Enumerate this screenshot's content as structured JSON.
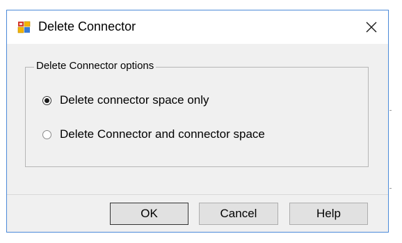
{
  "window": {
    "title": "Delete Connector",
    "app_icon": "app-icon",
    "close_icon": "close-icon"
  },
  "group": {
    "legend": "Delete Connector options",
    "options": [
      {
        "label": "Delete connector space only",
        "checked": true
      },
      {
        "label": "Delete Connector and connector space",
        "checked": false
      }
    ]
  },
  "buttons": {
    "ok": "OK",
    "cancel": "Cancel",
    "help": "Help"
  },
  "colors": {
    "window_border": "#4a89d8",
    "dialog_background": "#f0f0f0",
    "button_face": "#e1e1e1"
  }
}
